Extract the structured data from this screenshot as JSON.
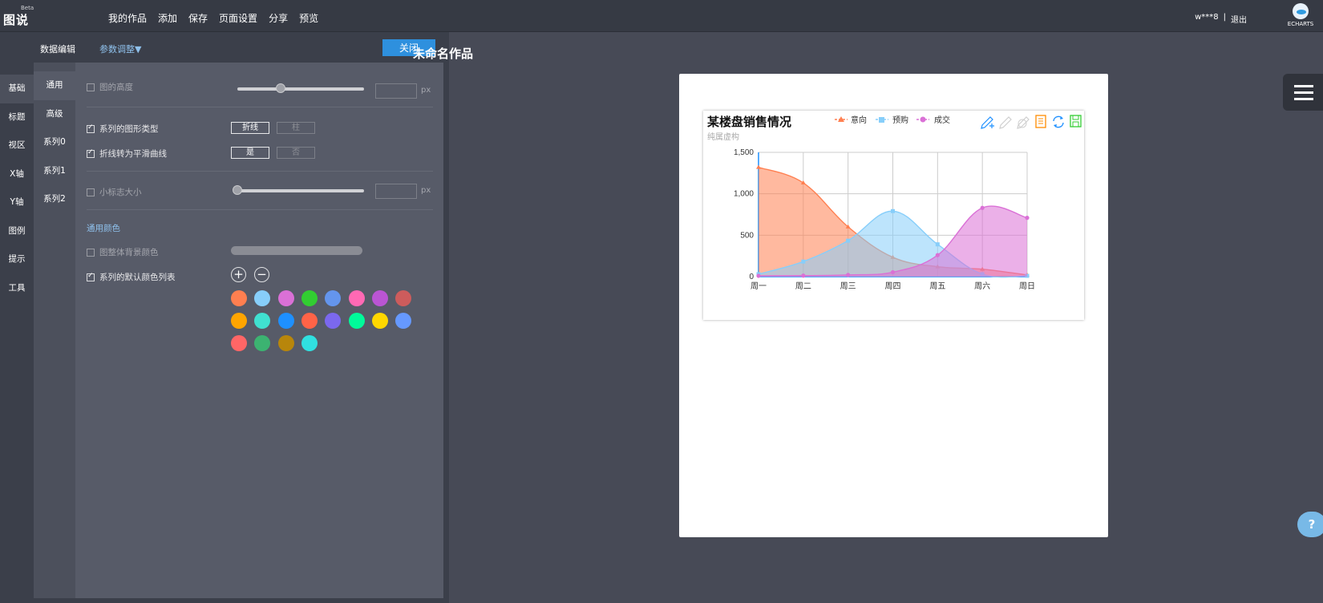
{
  "app": {
    "logo": "图说",
    "badge": "Beta"
  },
  "topnav": [
    "我的作品",
    "添加",
    "保存",
    "页面设置",
    "分享",
    "预览"
  ],
  "user": {
    "name": "w***8",
    "separator": "|",
    "logout": "退出"
  },
  "brand": {
    "label": "ECHARTS"
  },
  "panel": {
    "tab_data": "数据编辑",
    "tab_params": "参数调整▼",
    "close": "关闭"
  },
  "vnav": [
    "基础",
    "标题",
    "视区",
    "X轴",
    "Y轴",
    "图例",
    "提示",
    "工具"
  ],
  "subnav": [
    "通用",
    "高级",
    "系列0",
    "系列1",
    "系列2"
  ],
  "settings": {
    "chart_height": {
      "label": "图的高度",
      "unit": "px",
      "slider": 0.38,
      "checked": false
    },
    "series_type": {
      "label": "系列的图形类型",
      "opt_a": "折线",
      "opt_b": "柱",
      "checked": true
    },
    "smooth": {
      "label": "折线转为平滑曲线",
      "opt_a": "是",
      "opt_b": "否",
      "checked": true
    },
    "symbol_size": {
      "label": "小标志大小",
      "unit": "px",
      "slider": 0.0,
      "checked": false
    },
    "general_color_title": "通用颜色",
    "bg_color": {
      "label": "图整体背景颜色",
      "checked": false
    },
    "palette": {
      "label": "系列的默认颜色列表",
      "add": "+",
      "remove": "−",
      "checked": true,
      "colors": [
        "#ff7f50",
        "#87cefa",
        "#da70d6",
        "#32cd32",
        "#6495ed",
        "#ff69b4",
        "#ba55d3",
        "#cd5c5c",
        "#ffa500",
        "#40e0d0",
        "#1e90ff",
        "#ff6347",
        "#7b68ee",
        "#00fa9a",
        "#ffd700",
        "#6699ff",
        "#ff6666",
        "#3cb371",
        "#b8860b",
        "#30e0e0"
      ]
    }
  },
  "stage": {
    "title": "未命名作品"
  },
  "help": "?",
  "chart": {
    "title": "某楼盘销售情况",
    "subtitle": "纯属虚构",
    "legend": [
      "意向",
      "预购",
      "成交"
    ],
    "toolbox": [
      "mark-icon",
      "mark-undo-icon",
      "mark-clear-icon",
      "data-view-icon",
      "restore-icon",
      "save-image-icon"
    ]
  },
  "chart_data": {
    "type": "area",
    "title": "某楼盘销售情况",
    "subtitle": "纯属虚构",
    "categories": [
      "周一",
      "周二",
      "周三",
      "周四",
      "周五",
      "周六",
      "周日"
    ],
    "ylim": [
      0,
      1500
    ],
    "yticks": [
      "0",
      "500",
      "1,000",
      "1,500"
    ],
    "smooth": true,
    "grid": true,
    "legend_position": "top-center",
    "series": [
      {
        "name": "意向",
        "color": "#ff7f50",
        "values": [
          1320,
          1132,
          601,
          234,
          120,
          90,
          20
        ]
      },
      {
        "name": "预购",
        "color": "#87cefa",
        "values": [
          30,
          182,
          434,
          791,
          390,
          30,
          10
        ]
      },
      {
        "name": "成交",
        "color": "#da70d6",
        "values": [
          10,
          12,
          21,
          54,
          260,
          830,
          710
        ]
      }
    ]
  }
}
